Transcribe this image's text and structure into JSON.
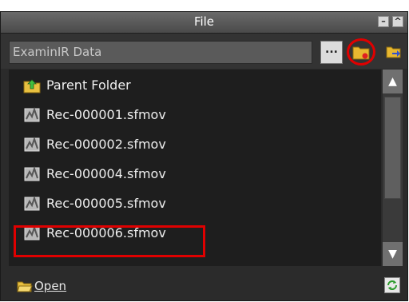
{
  "panel": {
    "title": "File",
    "minimize_label": "–",
    "collapse_label": "^"
  },
  "path": {
    "value": "ExaminIR Data",
    "browse_label": "..."
  },
  "files": [
    {
      "name": "Parent Folder",
      "icon": "parent-folder-icon"
    },
    {
      "name": "Rec-000001.sfmov",
      "icon": "movie-file-icon"
    },
    {
      "name": "Rec-000002.sfmov",
      "icon": "movie-file-icon"
    },
    {
      "name": "Rec-000004.sfmov",
      "icon": "movie-file-icon"
    },
    {
      "name": "Rec-000005.sfmov",
      "icon": "movie-file-icon"
    },
    {
      "name": "Rec-000006.sfmov",
      "icon": "movie-file-icon"
    }
  ],
  "scrollbar": {
    "up": "▲",
    "down": "▼"
  },
  "bottom": {
    "open_label": "Open"
  },
  "colors": {
    "highlight": "#e00000",
    "panel_bg": "#2b2b2b"
  }
}
